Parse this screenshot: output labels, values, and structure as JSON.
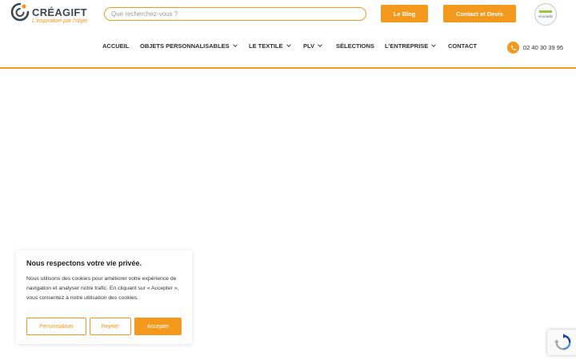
{
  "header": {
    "logo": {
      "name": "CRÉAGIFT",
      "tagline": "L'inspiration par l'objet"
    },
    "search": {
      "placeholder": "Que recherchez-vous ?",
      "value": ""
    },
    "buttons": {
      "blog": "Le Blog",
      "contact": "Contact et Devis"
    },
    "badge": {
      "text": "ecovadis"
    },
    "nav": [
      {
        "label": "ACCUEIL",
        "has_dropdown": false
      },
      {
        "label": "OBJETS PERSONNALISABLES",
        "has_dropdown": true
      },
      {
        "label": "LE TEXTILE",
        "has_dropdown": true
      },
      {
        "label": "PLV",
        "has_dropdown": true
      },
      {
        "label": "SÉLECTIONS",
        "has_dropdown": false
      },
      {
        "label": "L'ENTREPRISE",
        "has_dropdown": true
      },
      {
        "label": "CONTACT",
        "has_dropdown": false
      }
    ],
    "phone": "02 40 30 39 95"
  },
  "cookie": {
    "title": "Nous respectons votre vie privée.",
    "text": "Nous utilisons des cookies pour améliorer votre expérience de navigation et analyser notre trafic. En cliquant sur « Accepter », vous consentez à notre utilisation des cookies.",
    "buttons": {
      "customize": "Personnaliser",
      "reject": "Rejeter",
      "accept": "Accepter"
    }
  },
  "colors": {
    "accent": "#f39a1e",
    "text": "#2a2f33",
    "logo_dark": "#3a4750",
    "badge_green": "#9bc53d"
  },
  "icons": {
    "phone": "phone-icon",
    "recaptcha": "recaptcha-icon",
    "chevron": "chevron-down-icon"
  }
}
